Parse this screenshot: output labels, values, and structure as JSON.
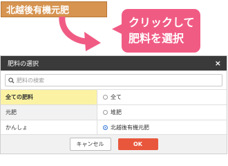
{
  "annotation": {
    "tag_text": "北越後有機元肥",
    "callout_line1": "クリックして",
    "callout_line2": "肥料を選択"
  },
  "dialog": {
    "title": "肥料の選択",
    "close_glyph": "×",
    "search_placeholder": "肥料の検索",
    "left_items": [
      "全ての肥料",
      "元肥",
      "かんしょ"
    ],
    "radio_options": [
      "全て",
      "堆肥",
      "北越後有機元肥"
    ],
    "selected_option": "北越後有機元肥",
    "cancel_label": "キャンセル",
    "ok_label": "OK"
  },
  "colors": {
    "tag_bg": "#d69450",
    "callout_bg": "#f05b84",
    "titlebar_bg": "#3a3a3a",
    "active_row_bg": "#fbf3a3",
    "ok_bg": "#e8573c"
  }
}
